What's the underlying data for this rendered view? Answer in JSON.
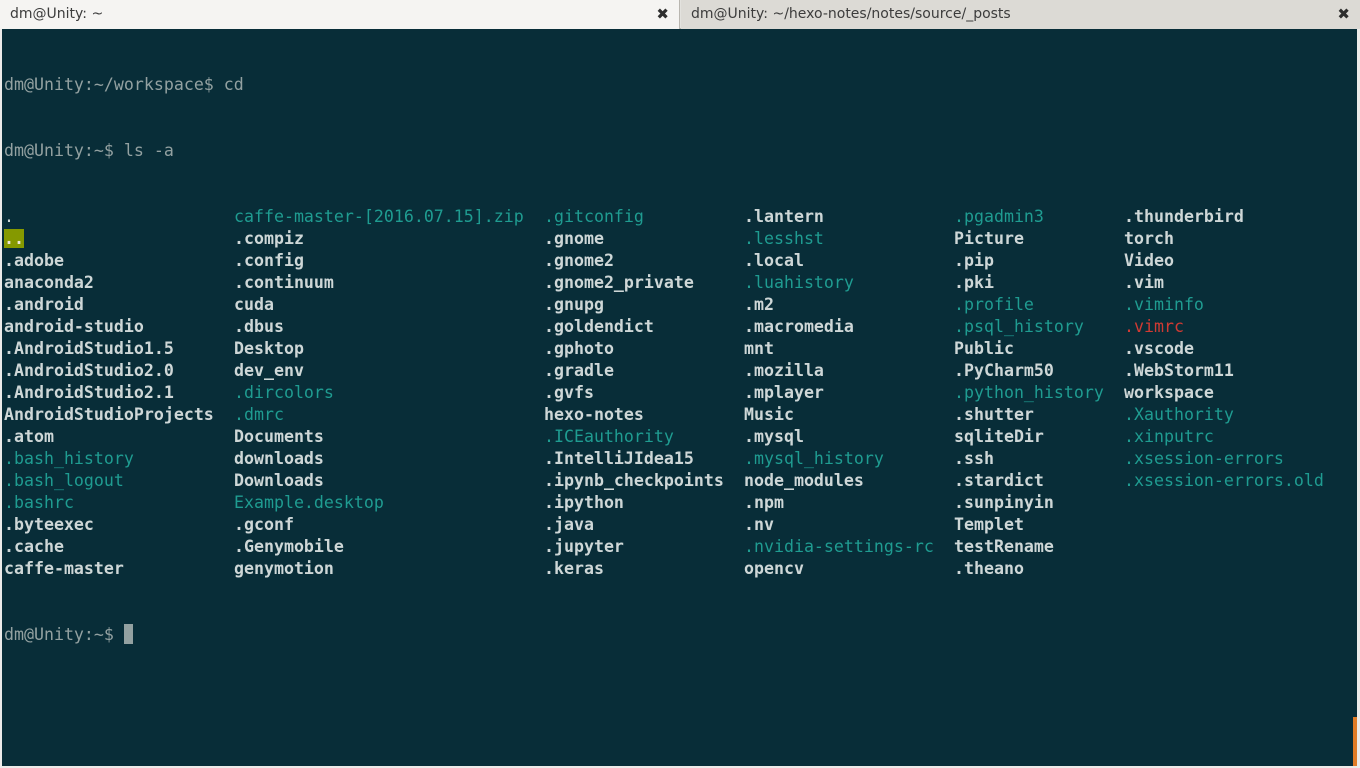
{
  "tabs": [
    {
      "title": "dm@Unity: ~",
      "close": "✖",
      "active": true
    },
    {
      "title": "dm@Unity: ~/hexo-notes/notes/source/_posts",
      "close": "✖",
      "active": false
    }
  ],
  "terminal": {
    "prompt_lines": [
      "dm@Unity:~/workspace$ cd",
      "dm@Unity:~$ ls -a"
    ],
    "listing_columns": [
      [
        {
          "name": ".",
          "style": "file"
        },
        {
          "name": "..",
          "style": "highlight"
        },
        {
          "name": ".adobe",
          "style": "dir"
        },
        {
          "name": "anaconda2",
          "style": "dir"
        },
        {
          "name": ".android",
          "style": "dir"
        },
        {
          "name": "android-studio",
          "style": "dir"
        },
        {
          "name": ".AndroidStudio1.5",
          "style": "dir"
        },
        {
          "name": ".AndroidStudio2.0",
          "style": "dir"
        },
        {
          "name": ".AndroidStudio2.1",
          "style": "dir"
        },
        {
          "name": "AndroidStudioProjects",
          "style": "dir"
        },
        {
          "name": ".atom",
          "style": "dir"
        },
        {
          "name": ".bash_history",
          "style": "hidden"
        },
        {
          "name": ".bash_logout",
          "style": "hidden"
        },
        {
          "name": ".bashrc",
          "style": "hidden"
        },
        {
          "name": ".byteexec",
          "style": "dir"
        },
        {
          "name": ".cache",
          "style": "dir"
        },
        {
          "name": "caffe-master",
          "style": "dir"
        }
      ],
      [
        {
          "name": "caffe-master-[2016.07.15].zip",
          "style": "hidden"
        },
        {
          "name": ".compiz",
          "style": "dir"
        },
        {
          "name": ".config",
          "style": "dir"
        },
        {
          "name": ".continuum",
          "style": "dir"
        },
        {
          "name": "cuda",
          "style": "dir"
        },
        {
          "name": ".dbus",
          "style": "dir"
        },
        {
          "name": "Desktop",
          "style": "dir"
        },
        {
          "name": "dev_env",
          "style": "dir"
        },
        {
          "name": ".dircolors",
          "style": "hidden"
        },
        {
          "name": ".dmrc",
          "style": "hidden"
        },
        {
          "name": "Documents",
          "style": "dir"
        },
        {
          "name": "downloads",
          "style": "dir"
        },
        {
          "name": "Downloads",
          "style": "dir"
        },
        {
          "name": "Example.desktop",
          "style": "hidden"
        },
        {
          "name": ".gconf",
          "style": "dir"
        },
        {
          "name": ".Genymobile",
          "style": "dir"
        },
        {
          "name": "genymotion",
          "style": "dir"
        }
      ],
      [
        {
          "name": ".gitconfig",
          "style": "hidden"
        },
        {
          "name": ".gnome",
          "style": "dir"
        },
        {
          "name": ".gnome2",
          "style": "dir"
        },
        {
          "name": ".gnome2_private",
          "style": "dir"
        },
        {
          "name": ".gnupg",
          "style": "dir"
        },
        {
          "name": ".goldendict",
          "style": "dir"
        },
        {
          "name": ".gphoto",
          "style": "dir"
        },
        {
          "name": ".gradle",
          "style": "dir"
        },
        {
          "name": ".gvfs",
          "style": "dir"
        },
        {
          "name": "hexo-notes",
          "style": "dir"
        },
        {
          "name": ".ICEauthority",
          "style": "hidden"
        },
        {
          "name": ".IntelliJIdea15",
          "style": "dir"
        },
        {
          "name": ".ipynb_checkpoints",
          "style": "dir"
        },
        {
          "name": ".ipython",
          "style": "dir"
        },
        {
          "name": ".java",
          "style": "dir"
        },
        {
          "name": ".jupyter",
          "style": "dir"
        },
        {
          "name": ".keras",
          "style": "dir"
        }
      ],
      [
        {
          "name": ".lantern",
          "style": "dir"
        },
        {
          "name": ".lesshst",
          "style": "hidden"
        },
        {
          "name": ".local",
          "style": "dir"
        },
        {
          "name": ".luahistory",
          "style": "hidden"
        },
        {
          "name": ".m2",
          "style": "dir"
        },
        {
          "name": ".macromedia",
          "style": "dir"
        },
        {
          "name": "mnt",
          "style": "dir"
        },
        {
          "name": ".mozilla",
          "style": "dir"
        },
        {
          "name": ".mplayer",
          "style": "dir"
        },
        {
          "name": "Music",
          "style": "dir"
        },
        {
          "name": ".mysql",
          "style": "dir"
        },
        {
          "name": ".mysql_history",
          "style": "hidden"
        },
        {
          "name": "node_modules",
          "style": "dir"
        },
        {
          "name": ".npm",
          "style": "dir"
        },
        {
          "name": ".nv",
          "style": "dir"
        },
        {
          "name": ".nvidia-settings-rc",
          "style": "hidden"
        },
        {
          "name": "opencv",
          "style": "dir"
        }
      ],
      [
        {
          "name": ".pgadmin3",
          "style": "hidden"
        },
        {
          "name": "Picture",
          "style": "dir"
        },
        {
          "name": ".pip",
          "style": "dir"
        },
        {
          "name": ".pki",
          "style": "dir"
        },
        {
          "name": ".profile",
          "style": "hidden"
        },
        {
          "name": ".psql_history",
          "style": "hidden"
        },
        {
          "name": "Public",
          "style": "dir"
        },
        {
          "name": ".PyCharm50",
          "style": "dir"
        },
        {
          "name": ".python_history",
          "style": "hidden"
        },
        {
          "name": ".shutter",
          "style": "dir"
        },
        {
          "name": "sqliteDir",
          "style": "dir"
        },
        {
          "name": ".ssh",
          "style": "dir"
        },
        {
          "name": ".stardict",
          "style": "dir"
        },
        {
          "name": ".sunpinyin",
          "style": "dir"
        },
        {
          "name": "Templet",
          "style": "dir"
        },
        {
          "name": "testRename",
          "style": "dir"
        },
        {
          "name": ".theano",
          "style": "dir"
        }
      ],
      [
        {
          "name": ".thunderbird",
          "style": "dir"
        },
        {
          "name": "torch",
          "style": "dir"
        },
        {
          "name": "Video",
          "style": "dir"
        },
        {
          "name": ".vim",
          "style": "dir"
        },
        {
          "name": ".viminfo",
          "style": "hidden"
        },
        {
          "name": ".vimrc",
          "style": "red"
        },
        {
          "name": ".vscode",
          "style": "dir"
        },
        {
          "name": ".WebStorm11",
          "style": "dir"
        },
        {
          "name": "workspace",
          "style": "dir"
        },
        {
          "name": ".Xauthority",
          "style": "hidden"
        },
        {
          "name": ".xinputrc",
          "style": "hidden"
        },
        {
          "name": ".xsession-errors",
          "style": "hidden"
        },
        {
          "name": ".xsession-errors.old",
          "style": "hidden"
        }
      ]
    ],
    "final_prompt": "dm@Unity:~$ "
  },
  "colors": {
    "terminal_background": "#082d38",
    "directory": "#ced7d7",
    "hidden_file": "#1f9c91",
    "highlight": "#859900",
    "warning_file": "#d03a33",
    "scroll_marker": "#e07c27"
  }
}
